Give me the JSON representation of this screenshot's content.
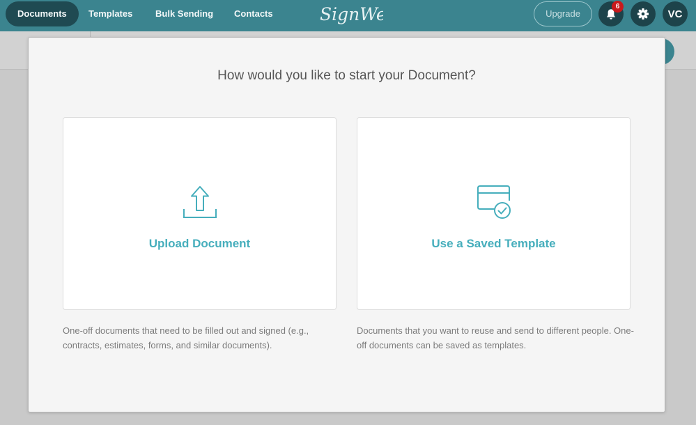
{
  "nav": {
    "tabs": [
      "Documents",
      "Templates",
      "Bulk Sending",
      "Contacts"
    ],
    "active_tab": "Documents",
    "logo_text": "SignWell",
    "upgrade_label": "Upgrade",
    "notification_count": "6",
    "notification_icon": "bell-icon",
    "settings_icon": "gear-icon",
    "avatar_initials": "VC"
  },
  "modal": {
    "title": "How would you like to start your Document?",
    "options": [
      {
        "label": "Upload Document",
        "icon": "upload-icon",
        "description": "One-off documents that need to be filled out and signed (e.g., contracts, estimates, forms, and similar documents)."
      },
      {
        "label": "Use a Saved Template",
        "icon": "saved-template-icon",
        "description": "Documents that you want to reuse and send to different people. One-off documents can be saved as templates."
      }
    ]
  },
  "colors": {
    "header": "#3b848f",
    "active_tab": "#1f4a52",
    "accent": "#46aebc",
    "badge": "#c8191c"
  }
}
